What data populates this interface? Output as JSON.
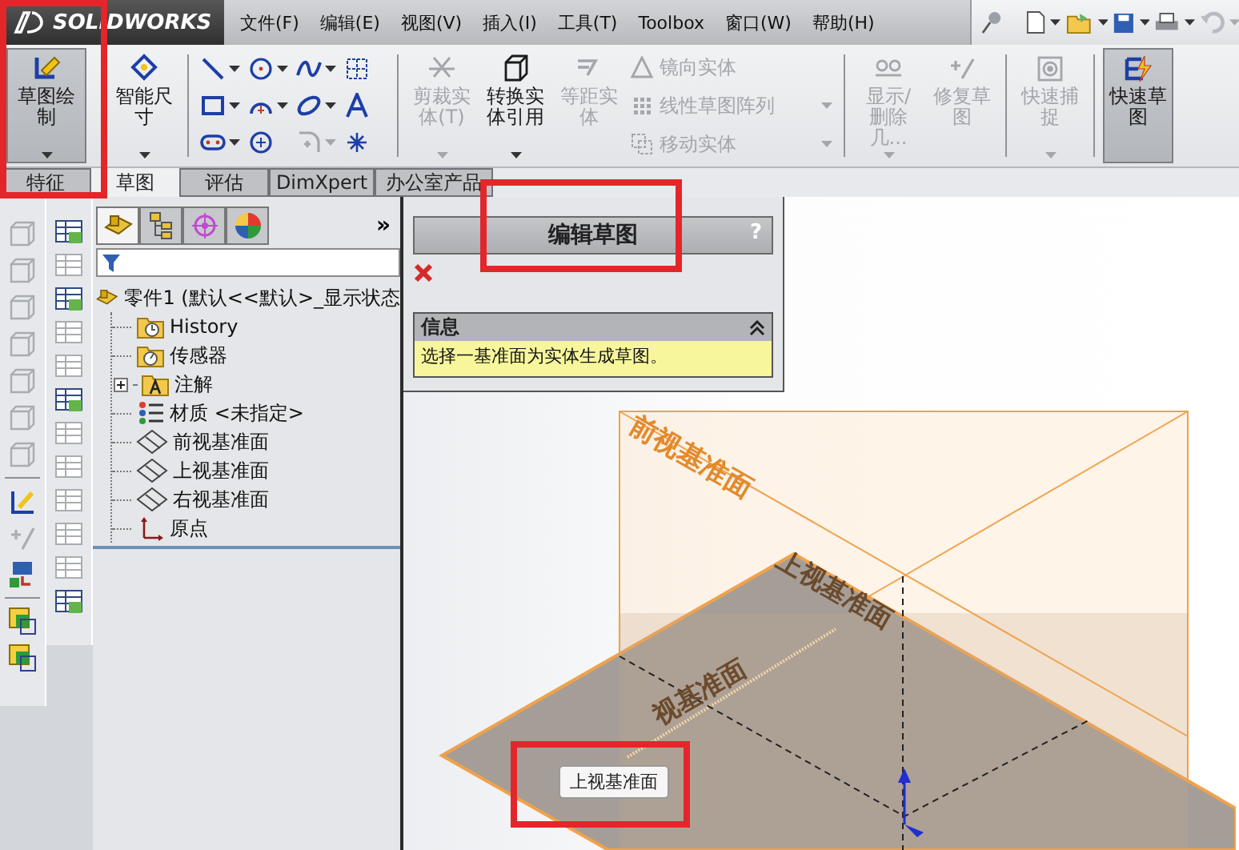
{
  "app": {
    "brand": "SOLIDWORKS"
  },
  "menu": [
    "文件(F)",
    "编辑(E)",
    "视图(V)",
    "插入(I)",
    "工具(T)",
    "Toolbox",
    "窗口(W)",
    "帮助(H)"
  ],
  "ribbon": [
    {
      "kind": "large",
      "label": "草图绘制",
      "pressed": true,
      "disabled": false,
      "dropdown": true
    },
    {
      "kind": "large",
      "label": "智能尺寸",
      "pressed": false,
      "disabled": false,
      "dropdown": true
    },
    {
      "kind": "separator"
    },
    {
      "kind": "grid",
      "tools": [
        {
          "disabled": false,
          "dropdown": true
        },
        {
          "disabled": false,
          "dropdown": true
        },
        {
          "disabled": false,
          "dropdown": true
        },
        {
          "disabled": false,
          "dropdown": false
        },
        {
          "disabled": false,
          "dropdown": true
        },
        {
          "disabled": false,
          "dropdown": true
        },
        {
          "disabled": false,
          "dropdown": true
        },
        {
          "disabled": false,
          "dropdown": false
        },
        {
          "disabled": false,
          "dropdown": true
        },
        {
          "disabled": false,
          "dropdown": false
        },
        {
          "disabled": true,
          "dropdown": true
        },
        {
          "disabled": false,
          "dropdown": false
        }
      ]
    },
    {
      "kind": "separator"
    },
    {
      "kind": "large",
      "label": "剪裁实体(T)",
      "pressed": false,
      "disabled": true,
      "dropdown": true
    },
    {
      "kind": "large",
      "label": "转换实体引用",
      "pressed": false,
      "disabled": false,
      "dropdown": true
    },
    {
      "kind": "large",
      "label": "等距实体",
      "pressed": false,
      "disabled": true,
      "dropdown": false
    },
    {
      "kind": "stack",
      "items": [
        {
          "label": "镜向实体",
          "disabled": true,
          "dropdown": false
        },
        {
          "label": "线性草图阵列",
          "disabled": true,
          "dropdown": true
        },
        {
          "label": "移动实体",
          "disabled": true,
          "dropdown": true
        }
      ]
    },
    {
      "kind": "separator"
    },
    {
      "kind": "large",
      "label": "显示/删除几...",
      "pressed": false,
      "disabled": true,
      "dropdown": true
    },
    {
      "kind": "large",
      "label": "修复草图",
      "pressed": false,
      "disabled": true,
      "dropdown": false
    },
    {
      "kind": "separator"
    },
    {
      "kind": "large",
      "label": "快速捕捉",
      "pressed": false,
      "disabled": true,
      "dropdown": true
    },
    {
      "kind": "separator"
    },
    {
      "kind": "large",
      "label": "快速草图",
      "pressed": true,
      "disabled": false,
      "dropdown": false
    }
  ],
  "tabs": [
    {
      "label": "特征",
      "selected": false
    },
    {
      "label": "草图",
      "selected": true
    },
    {
      "label": "评估",
      "selected": false
    },
    {
      "label": "DimXpert",
      "selected": false
    },
    {
      "label": "办公室产品",
      "selected": false
    }
  ],
  "tree": {
    "tabs": [
      {
        "selected": true
      },
      {
        "selected": false
      },
      {
        "selected": false
      },
      {
        "selected": false
      }
    ],
    "more": "»",
    "root": {
      "label": "零件1  (默认<<默认>_显示状态",
      "children": [
        {
          "label": "History",
          "kind": "history"
        },
        {
          "label": "传感器",
          "kind": "sensors"
        },
        {
          "label": "注解",
          "kind": "annotations",
          "expanded": false
        },
        {
          "label": "材质 <未指定>",
          "kind": "material"
        },
        {
          "label": "前视基准面",
          "kind": "plane"
        },
        {
          "label": "上视基准面",
          "kind": "plane"
        },
        {
          "label": "右视基准面",
          "kind": "plane"
        },
        {
          "label": "原点",
          "kind": "origin"
        }
      ]
    }
  },
  "property_manager": {
    "title": "编辑草图",
    "help": "?",
    "sections": [
      {
        "title": "信息",
        "expanded": true,
        "message": "选择一基准面为实体生成草图。"
      }
    ]
  },
  "viewport": {
    "plane_labels": [
      "前视基准面",
      "上视基准面",
      "视基准面"
    ],
    "tooltip": "上视基准面"
  },
  "highlight_frames": [
    {
      "kind": "frame"
    },
    {
      "kind": "frame"
    },
    {
      "kind": "frame"
    }
  ]
}
